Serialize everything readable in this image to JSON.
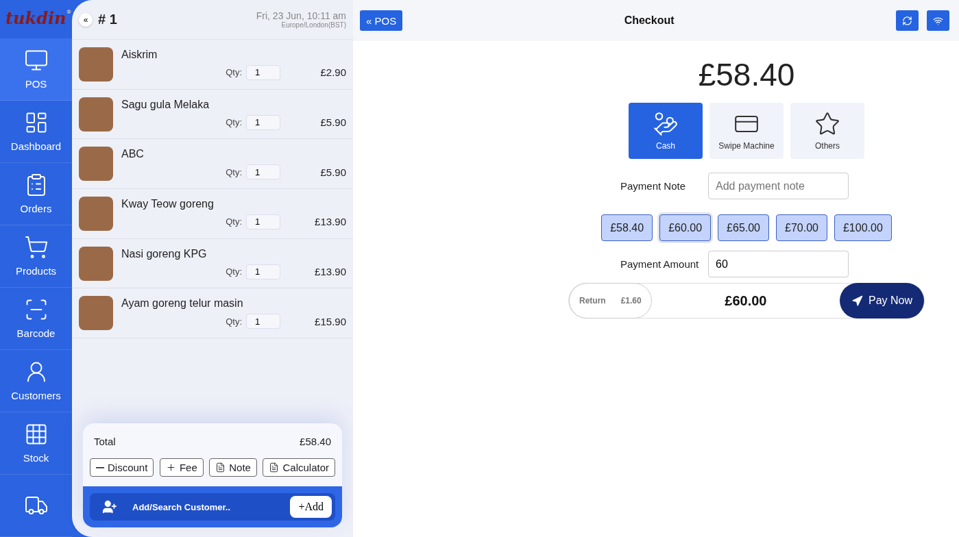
{
  "brand": {
    "logo": "tukdin",
    "mark": "®"
  },
  "sidebar": {
    "items": [
      {
        "label": "POS",
        "selected": true
      },
      {
        "label": "Dashboard",
        "selected": false
      },
      {
        "label": "Orders",
        "selected": false
      },
      {
        "label": "Products",
        "selected": false
      },
      {
        "label": "Barcode",
        "selected": false
      },
      {
        "label": "Customers",
        "selected": false
      },
      {
        "label": "Stock",
        "selected": false
      }
    ]
  },
  "cart": {
    "collapse": "«",
    "order_no": "# 1",
    "date": "Fri, 23 Jun, 10:11 am",
    "timezone": "Europe/London(BST)",
    "items": [
      {
        "name": "Aiskrim",
        "qty_label": "Qty:",
        "qty": "1",
        "price": "£2.90"
      },
      {
        "name": "Sagu gula Melaka",
        "qty_label": "Qty:",
        "qty": "1",
        "price": "£5.90"
      },
      {
        "name": "ABC",
        "qty_label": "Qty:",
        "qty": "1",
        "price": "£5.90"
      },
      {
        "name": "Kway Teow goreng",
        "qty_label": "Qty:",
        "qty": "1",
        "price": "£13.90"
      },
      {
        "name": "Nasi goreng KPG",
        "qty_label": "Qty:",
        "qty": "1",
        "price": "£13.90"
      },
      {
        "name": "Ayam goreng telur masin",
        "qty_label": "Qty:",
        "qty": "1",
        "price": "£15.90"
      }
    ],
    "total_label": "Total",
    "total": "£58.40",
    "actions": [
      {
        "label": "Discount",
        "kind": "minus"
      },
      {
        "label": "Fee",
        "kind": "plus"
      },
      {
        "label": "Note",
        "kind": "doc"
      },
      {
        "label": "Calculator",
        "kind": "doc"
      }
    ],
    "customer": {
      "label": "Add/Search Customer..",
      "add": "Add",
      "add_sign": "+"
    }
  },
  "checkout": {
    "back": "POS",
    "back_sign": "«",
    "title": "Checkout",
    "amount": "£58.40",
    "methods": [
      {
        "label": "Cash",
        "selected": true
      },
      {
        "label": "Swipe Machine",
        "selected": false
      },
      {
        "label": "Others",
        "selected": false
      }
    ],
    "note_label": "Payment Note",
    "note_placeholder": "Add payment note",
    "quick": [
      {
        "label": "£58.40",
        "selected": false
      },
      {
        "label": "£60.00",
        "selected": true
      },
      {
        "label": "£65.00",
        "selected": false
      },
      {
        "label": "£70.00",
        "selected": false
      },
      {
        "label": "£100.00",
        "selected": false
      }
    ],
    "amount_label": "Payment Amount",
    "amount_value": "60",
    "return_label": "Return",
    "return_value": "£1.60",
    "paid": "£60.00",
    "pay": "Pay Now"
  }
}
